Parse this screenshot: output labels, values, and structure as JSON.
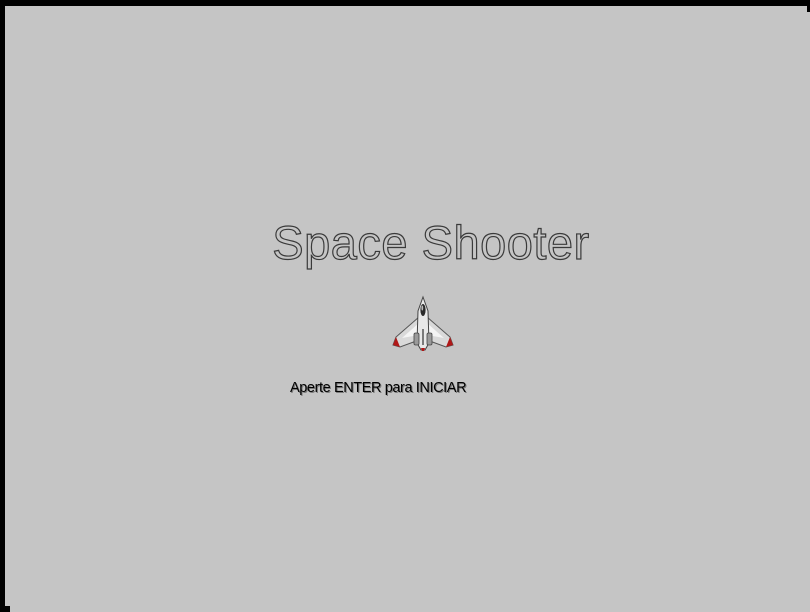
{
  "game": {
    "title": "Space Shooter",
    "start_prompt": "Aperte ENTER para INICIAR",
    "player_ship_icon": "fighter-jet-icon",
    "colors": {
      "background": "#c5c5c5",
      "border": "#000000",
      "title_outline": "#3a3a3a",
      "prompt_text": "#000000",
      "ship_accent": "#b01818"
    }
  }
}
